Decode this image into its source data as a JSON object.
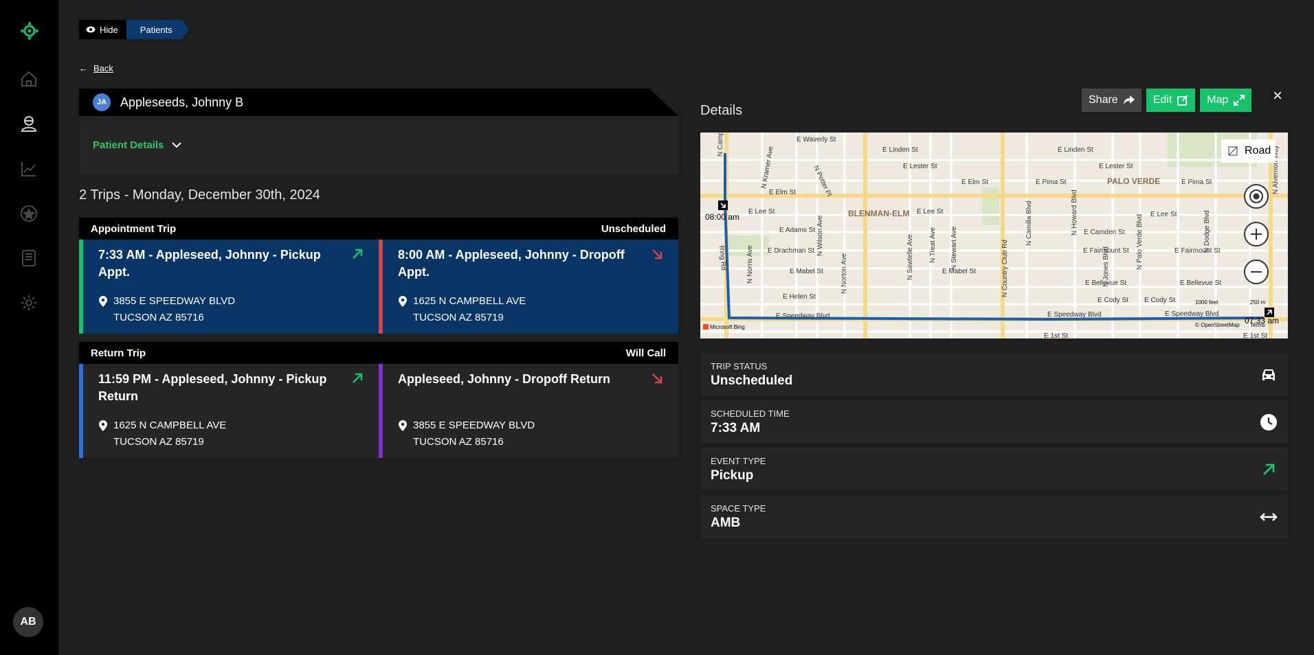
{
  "sidebar": {
    "avatar_initials": "AB",
    "icons": [
      "home-icon",
      "patient-icon",
      "analytics-icon",
      "favorites-icon",
      "book-icon",
      "settings-icon"
    ]
  },
  "breadcrumb": {
    "hide_label": "Hide",
    "current": "Patients"
  },
  "back_label": "Back",
  "patient": {
    "initials": "JA",
    "name": "Appleseeds, Johnny B",
    "details_label": "Patient Details"
  },
  "trips_title": "2 Trips - Monday, December 30th, 2024",
  "trips": [
    {
      "label": "Appointment Trip",
      "status": "Unscheduled",
      "legs": [
        {
          "title": "7:33 AM - Appleseed, Johnny - Pickup Appt.",
          "addr1": "3855 E SPEEDWAY BLVD",
          "addr2": "TUCSON AZ 85716",
          "direction": "pickup"
        },
        {
          "title": "8:00 AM - Appleseed, Johnny - Dropoff Appt.",
          "addr1": "1625 N CAMPBELL AVE",
          "addr2": "TUCSON AZ 85719",
          "direction": "dropoff"
        }
      ]
    },
    {
      "label": "Return Trip",
      "status": "Will Call",
      "legs": [
        {
          "title": "11:59 PM - Appleseed, Johnny - Pickup Return",
          "addr1": "1625 N CAMPBELL AVE",
          "addr2": "TUCSON AZ 85719",
          "direction": "pickup"
        },
        {
          "title": "Appleseed, Johnny - Dropoff Return",
          "addr1": "3855 E SPEEDWAY BLVD",
          "addr2": "TUCSON AZ 85716",
          "direction": "dropoff"
        }
      ]
    }
  ],
  "details": {
    "title": "Details",
    "share_label": "Share",
    "edit_label": "Edit",
    "map_label": "Map",
    "close_label": "×"
  },
  "map": {
    "road_label": "Road",
    "dropoff_time": "08:00 am",
    "pickup_time": "07:33 am",
    "neighborhoods": [
      "BLENMAN-ELM",
      "PALO VERDE"
    ],
    "streets": [
      "E Waverly St",
      "E Linden St",
      "E Lester St",
      "E Elm St",
      "E Pima St",
      "E Lee St",
      "E Adams St",
      "E Drachman St",
      "E Mabel St",
      "E Helen St",
      "E Speedway Blvd",
      "E Camden St",
      "E Fairmount St",
      "E Bellevue St",
      "E Cody St",
      "E 1st St",
      "N Campbell Ave",
      "N Norris Ave",
      "N Wilson Ave",
      "N Norton Ave",
      "N Sawtelle Ave",
      "N Treat Ave",
      "N Stewart Ave",
      "N Country Club Rd",
      "N Camilla Blvd",
      "N Howard Blvd",
      "N Jones Blvd",
      "N Palo Verde Blvd",
      "N Dodge Blvd",
      "N Alvernon Way",
      "N Kramer Ave",
      "N Potter Pl",
      "Ring Rd"
    ],
    "scale_feet": "1000 feet",
    "scale_m": "250 m",
    "attribution": "© OpenStreetMap",
    "terms": "Terms",
    "bing": "Microsoft Bing"
  },
  "info": [
    {
      "key": "TRIP STATUS",
      "value": "Unscheduled",
      "icon": "car-icon"
    },
    {
      "key": "SCHEDULED TIME",
      "value": "7:33 AM",
      "icon": "clock-icon"
    },
    {
      "key": "EVENT TYPE",
      "value": "Pickup",
      "icon": "arrow-up-right-icon"
    },
    {
      "key": "SPACE TYPE",
      "value": "AMB",
      "icon": "arrows-horizontal-icon"
    }
  ],
  "colors": {
    "green": "#17c36a",
    "red": "#d8424b",
    "blue": "#2f6fe0",
    "purple": "#7e2fd6",
    "navy": "#063566"
  }
}
